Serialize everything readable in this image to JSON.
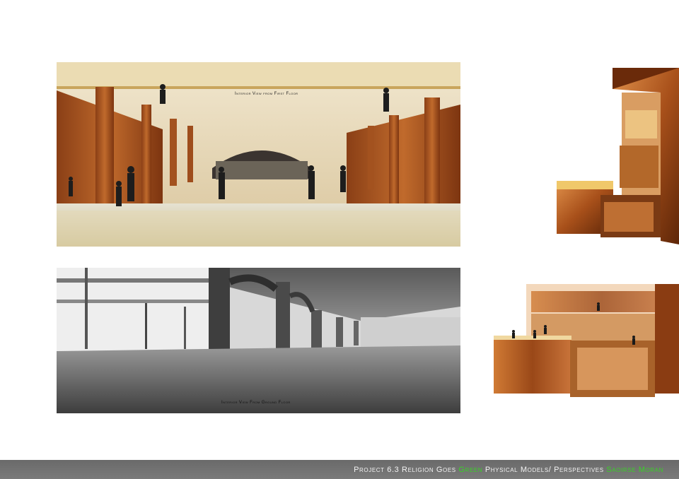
{
  "captions": {
    "first_floor": "Interior View from First Floor",
    "ground_floor": "Interior View From Ground Floor"
  },
  "footer": {
    "project": "Project 6.3 Religion Goes",
    "green_word": "Green",
    "subtitle": "Physical Models/ Perspectives",
    "author": "Saoirse Moran"
  },
  "colors": {
    "footer_bar": "#6e6e6e",
    "highlight_green": "#39d226",
    "wood": "#b5622a"
  }
}
